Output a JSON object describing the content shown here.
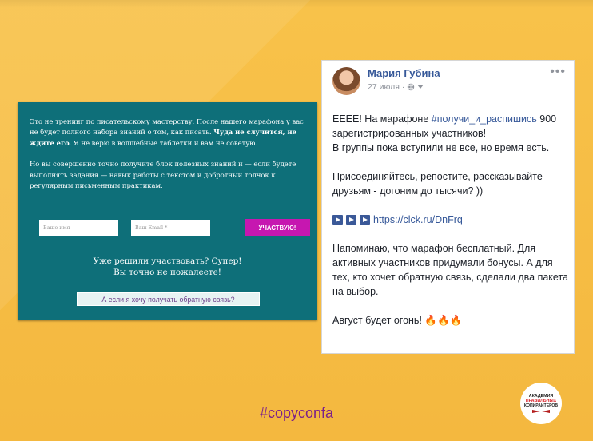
{
  "left_card": {
    "para1_a": "Это не тренинг по писательскому мастерству. После нашего марафона у вас не будет полного набора знаний о том, как писать. ",
    "para1_bold": "Чуда не случится, не ждите его",
    "para1_b": ". Я не верю в волшебные таблетки и вам не советую.",
    "para2": "Но вы совершенно точно получите блок полезных знаний и — если будете выполнять задания — навык работы с текстом и добротный толчок к регулярным письменным практикам.",
    "name_placeholder": "Ваше имя",
    "email_placeholder": "Ваш Email *",
    "join_label": "УЧАСТВУЮ!",
    "cta_line1": "Уже решили участвовать? Супер!",
    "cta_line2": "Вы точно не пожалеете!",
    "feedback_label": "А если я хочу получать обратную связь?"
  },
  "fb_post": {
    "author": "Мария Губина",
    "date": "27 июля ·",
    "more": "•••",
    "p1_a": "ЕЕЕЕ! На марафоне ",
    "p1_hashtag": "#получи_и_распишись",
    "p1_b": " 900 зарегистрированных участников!",
    "p1_c": "В группы пока вступили не все, но время есть.",
    "p2": "Присоединяйтесь, репостите, рассказывайте друзьям - догоним до тысячи? ))",
    "link": "https://clck.ru/DnFrq",
    "p3": "Напоминаю, что марафон бесплатный. Для активных участников придумали бонусы. А для тех, кто хочет обратную связь, сделали два пакета на выбор.",
    "p4": "Август будет огонь!",
    "fire_emoji": "🔥🔥🔥"
  },
  "footer": {
    "hashtag": "#copyconfa",
    "logo_l1": "АКАДЕМИЯ",
    "logo_l2": "ПРАВИЛЬНЫХ",
    "logo_l3": "КОПИРАЙТЕРОВ"
  },
  "colors": {
    "background": "#f6be45",
    "teal": "#0e6f79",
    "magenta_button": "#c617b0",
    "fb_link": "#365899",
    "hashtag_footer": "#7b1f8b"
  },
  "icons": [
    "globe-icon",
    "chevron-down-icon",
    "more-options-icon",
    "play-square-icon",
    "fire-icon"
  ]
}
